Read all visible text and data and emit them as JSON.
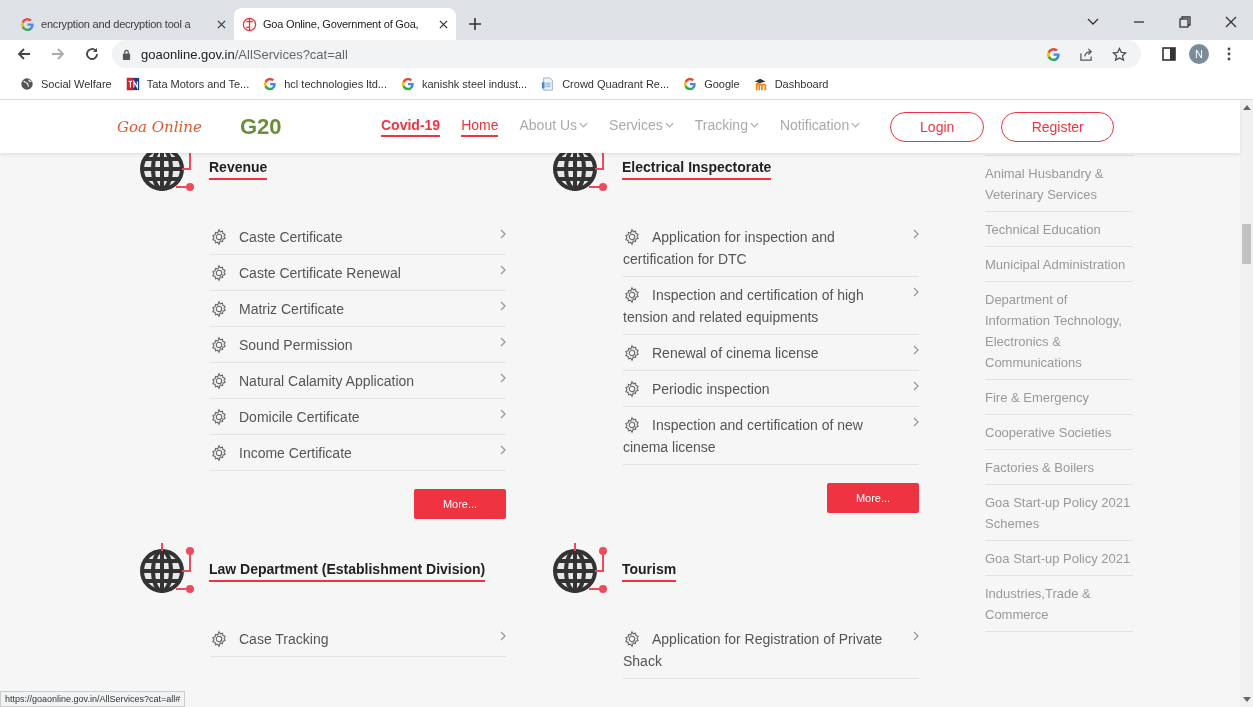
{
  "browser": {
    "tabs": [
      {
        "title": "encryption and decryption tool a",
        "kind": "google",
        "selected": false
      },
      {
        "title": "Goa Online, Government of Goa,",
        "kind": "goa",
        "selected": true
      }
    ],
    "address": {
      "host": "goaonline.gov.in",
      "path": "/AllServices?cat=all"
    },
    "avatar": "N",
    "bookmarks": [
      {
        "label": "Social Welfare",
        "kind": "globe"
      },
      {
        "label": "Tata Motors and Te...",
        "kind": "tn"
      },
      {
        "label": "hcl technologies ltd...",
        "kind": "google"
      },
      {
        "label": "kanishk steel indust...",
        "kind": "google"
      },
      {
        "label": "Crowd Quadrant Re...",
        "kind": "doc"
      },
      {
        "label": "Google",
        "kind": "google"
      },
      {
        "label": "Dashboard",
        "kind": "moodle"
      }
    ],
    "status_url": "https://goaonline.gov.in/AllServices?cat=all#"
  },
  "site": {
    "logo": "Goa Online",
    "g20": "G20",
    "nav": [
      {
        "label": "Covid-19",
        "kind": "alert",
        "selected": false
      },
      {
        "label": "Home",
        "kind": "page",
        "selected": true
      },
      {
        "label": "About Us",
        "kind": "menu",
        "selected": false
      },
      {
        "label": "Services",
        "kind": "menu",
        "selected": false
      },
      {
        "label": "Tracking",
        "kind": "menu",
        "selected": false
      },
      {
        "label": "Notification",
        "kind": "menu",
        "selected": false
      }
    ],
    "buttons": [
      "Login",
      "Register"
    ],
    "sections": [
      {
        "title": "Revenue",
        "items": [
          "Caste Certificate",
          "Caste Certificate Renewal",
          "Matriz Certificate",
          "Sound Permission",
          "Natural Calamity Application",
          "Domicile Certificate",
          "Income Certificate"
        ],
        "more": "More..."
      },
      {
        "title": "Electrical Inspectorate",
        "items": [
          "Application for inspection and certification for DTC",
          "Inspection and certification of high tension and related equipments",
          "Renewal of cinema license",
          "Periodic inspection",
          "Inspection and certification of new cinema license"
        ],
        "more": "More..."
      },
      {
        "title": "Law Department (Establishment Division)",
        "items": [
          "Case Tracking"
        ]
      },
      {
        "title": "Tourism",
        "items": [
          "Application for Registration of Private Shack"
        ]
      }
    ],
    "departments": [
      "Animal Husbandry & Veterinary Services",
      "Technical Education",
      "Municipal Administration",
      "Department of Information Technology, Electronics & Communications",
      "Fire & Emergency",
      "Cooperative Societies",
      "Factories & Boilers",
      "Goa Start-up Policy 2021 Schemes",
      "Goa Start-up Policy 2021",
      "Industries,Trade & Commerce"
    ]
  }
}
